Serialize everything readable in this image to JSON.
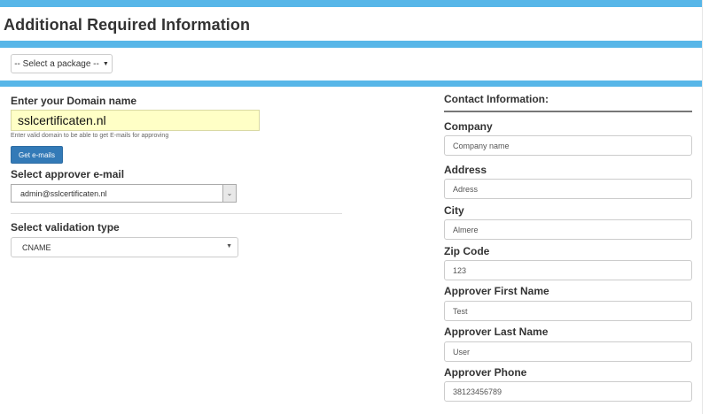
{
  "page_title": "Additional Required Information",
  "package_select": {
    "label": "-- Select a package --",
    "caret": "▼"
  },
  "domain": {
    "label": "Enter your Domain name",
    "value": "sslcertificaten.nl",
    "hint": "Enter valid domain to be able to get E-mails for approving"
  },
  "get_emails_label": "Get e-mails",
  "approver_email": {
    "label": "Select approver e-mail",
    "value": "admin@sslcertificaten.nl",
    "arrow": "⌄"
  },
  "validation": {
    "label": "Select validation type",
    "value": "CNAME",
    "arrow": "▼"
  },
  "contact": {
    "title": "Contact Information:",
    "fields": [
      {
        "label": "Company",
        "value": "Company name"
      },
      {
        "label": "Address",
        "value": "Adress"
      },
      {
        "label": "City",
        "value": "Almere"
      },
      {
        "label": "Zip Code",
        "value": "123"
      },
      {
        "label": "Approver First Name",
        "value": "Test"
      },
      {
        "label": "Approver Last Name",
        "value": "User"
      },
      {
        "label": "Approver Phone",
        "value": "38123456789"
      }
    ]
  },
  "colors": {
    "accent_bar": "#57b6e8",
    "primary_button": "#337ab7",
    "autofill_bg": "#ffffc6"
  }
}
